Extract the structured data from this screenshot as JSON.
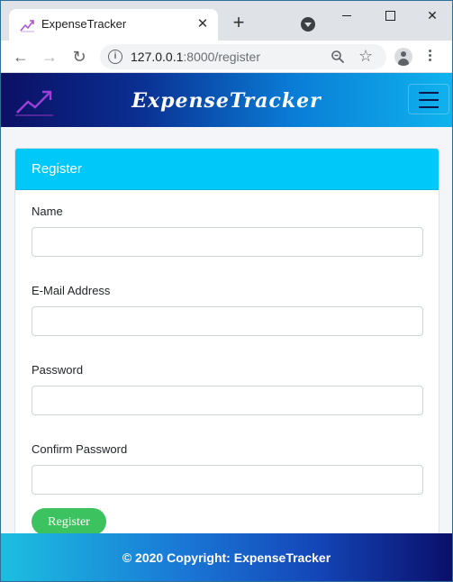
{
  "browser": {
    "tab_title": "ExpenseTracker",
    "url_host": "127.0.0.1",
    "url_rest": ":8000/register",
    "icons": {
      "tab_close": "close-icon",
      "new_tab": "plus-icon",
      "tab_search": "tab-search-icon",
      "back": "back-arrow-icon",
      "forward": "forward-arrow-icon",
      "reload": "reload-icon",
      "site_info": "info-icon",
      "zoom": "zoom-icon",
      "bookmark": "star-icon",
      "profile": "profile-icon",
      "menu": "kebab-menu-icon"
    },
    "glyphs": {
      "tab_close": "✕",
      "new_tab": "+",
      "back": "←",
      "forward": "→",
      "reload": "↻",
      "info": "i",
      "star": "☆"
    }
  },
  "navbar": {
    "brand": "ExpenseTracker",
    "logo_icon": "trending-chart-icon",
    "menu_icon": "hamburger-icon",
    "colors": {
      "gradient_start": "#0b1064",
      "gradient_end": "#0fb3ee"
    }
  },
  "register_card": {
    "header": "Register",
    "header_color": "#00c8f8",
    "fields": [
      {
        "label": "Name",
        "value": "",
        "placeholder": ""
      },
      {
        "label": "E-Mail Address",
        "value": "",
        "placeholder": ""
      },
      {
        "label": "Password",
        "value": "",
        "placeholder": ""
      },
      {
        "label": "Confirm Password",
        "value": "",
        "placeholder": ""
      }
    ],
    "submit_label": "Register",
    "submit_color": "#3cc35f"
  },
  "footer": {
    "text": "© 2020 Copyright: ExpenseTracker"
  }
}
